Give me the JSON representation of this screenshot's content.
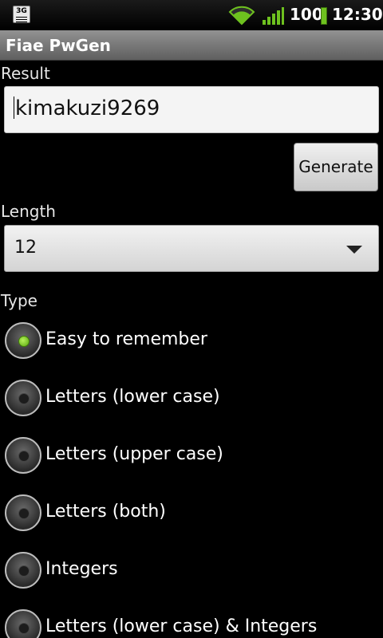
{
  "status_bar": {
    "network_badge": "3G",
    "battery_level": "100",
    "clock": "12:30",
    "icons": [
      "3g-icon",
      "wifi-icon",
      "signal-icon",
      "battery-icon"
    ],
    "accent": "#6ec11f"
  },
  "app": {
    "title": "Fiae PwGen"
  },
  "result": {
    "label": "Result",
    "value": "kimakuzi9269"
  },
  "generate_button": {
    "label": "Generate"
  },
  "length": {
    "label": "Length",
    "selected": "12"
  },
  "type": {
    "label": "Type",
    "options": [
      {
        "label": "Easy to remember",
        "checked": true
      },
      {
        "label": "Letters (lower case)",
        "checked": false
      },
      {
        "label": "Letters (upper case)",
        "checked": false
      },
      {
        "label": "Letters (both)",
        "checked": false
      },
      {
        "label": "Integers",
        "checked": false
      },
      {
        "label": "Letters (lower case) & Integers",
        "checked": false
      }
    ]
  }
}
